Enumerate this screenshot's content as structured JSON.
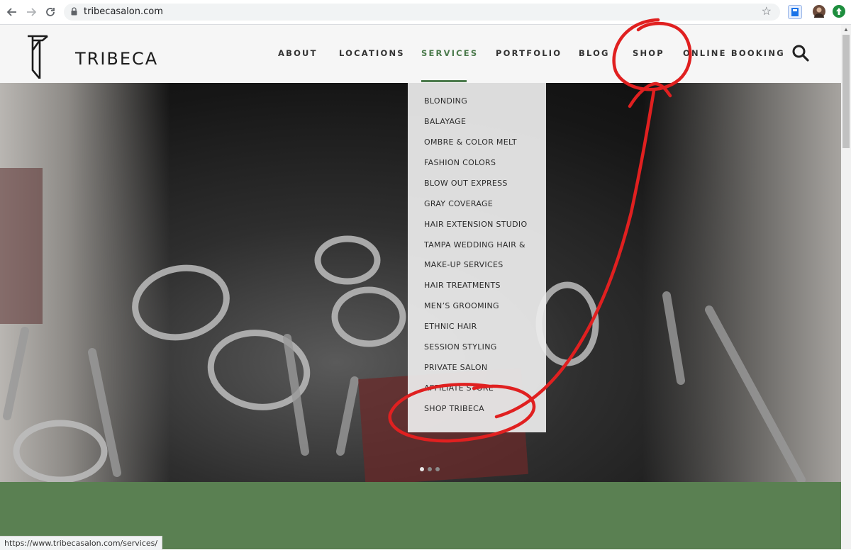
{
  "browser": {
    "url": "tribecasalon.com",
    "icons": [
      "back-arrow-icon",
      "forward-arrow-icon",
      "reload-icon",
      "lock-icon",
      "star-icon",
      "extension-icon",
      "avatar",
      "update-icon"
    ]
  },
  "site": {
    "logo_text": "TRIBECA",
    "menu": [
      {
        "label": "ABOUT"
      },
      {
        "label": "LOCATIONS"
      },
      {
        "label": "SERVICES"
      },
      {
        "label": "PORTFOLIO"
      },
      {
        "label": "BLOG"
      },
      {
        "label": "SHOP"
      },
      {
        "label": "ONLINE BOOKING"
      }
    ],
    "accent_color": "#4b7a4c"
  },
  "dropdown": {
    "items": [
      "BLONDING",
      "BALAYAGE",
      "OMBRE & COLOR MELT",
      "FASHION COLORS",
      "BLOW OUT EXPRESS",
      "GRAY COVERAGE",
      "HAIR EXTENSION STUDIO",
      "TAMPA WEDDING HAIR &",
      "MAKE-UP SERVICES",
      "HAIR TREATMENTS",
      "MEN’S GROOMING",
      "ETHNIC HAIR",
      "SESSION STYLING",
      "PRIVATE SALON",
      "AFFILIATE STORE",
      "SHOP TRIBECA"
    ]
  },
  "slider": {
    "total": 3,
    "active": 1
  },
  "status_url": "https://www.tribecasalon.com/services/",
  "colors": {
    "green_band": "#5a8052",
    "annotation": "#e02020"
  }
}
